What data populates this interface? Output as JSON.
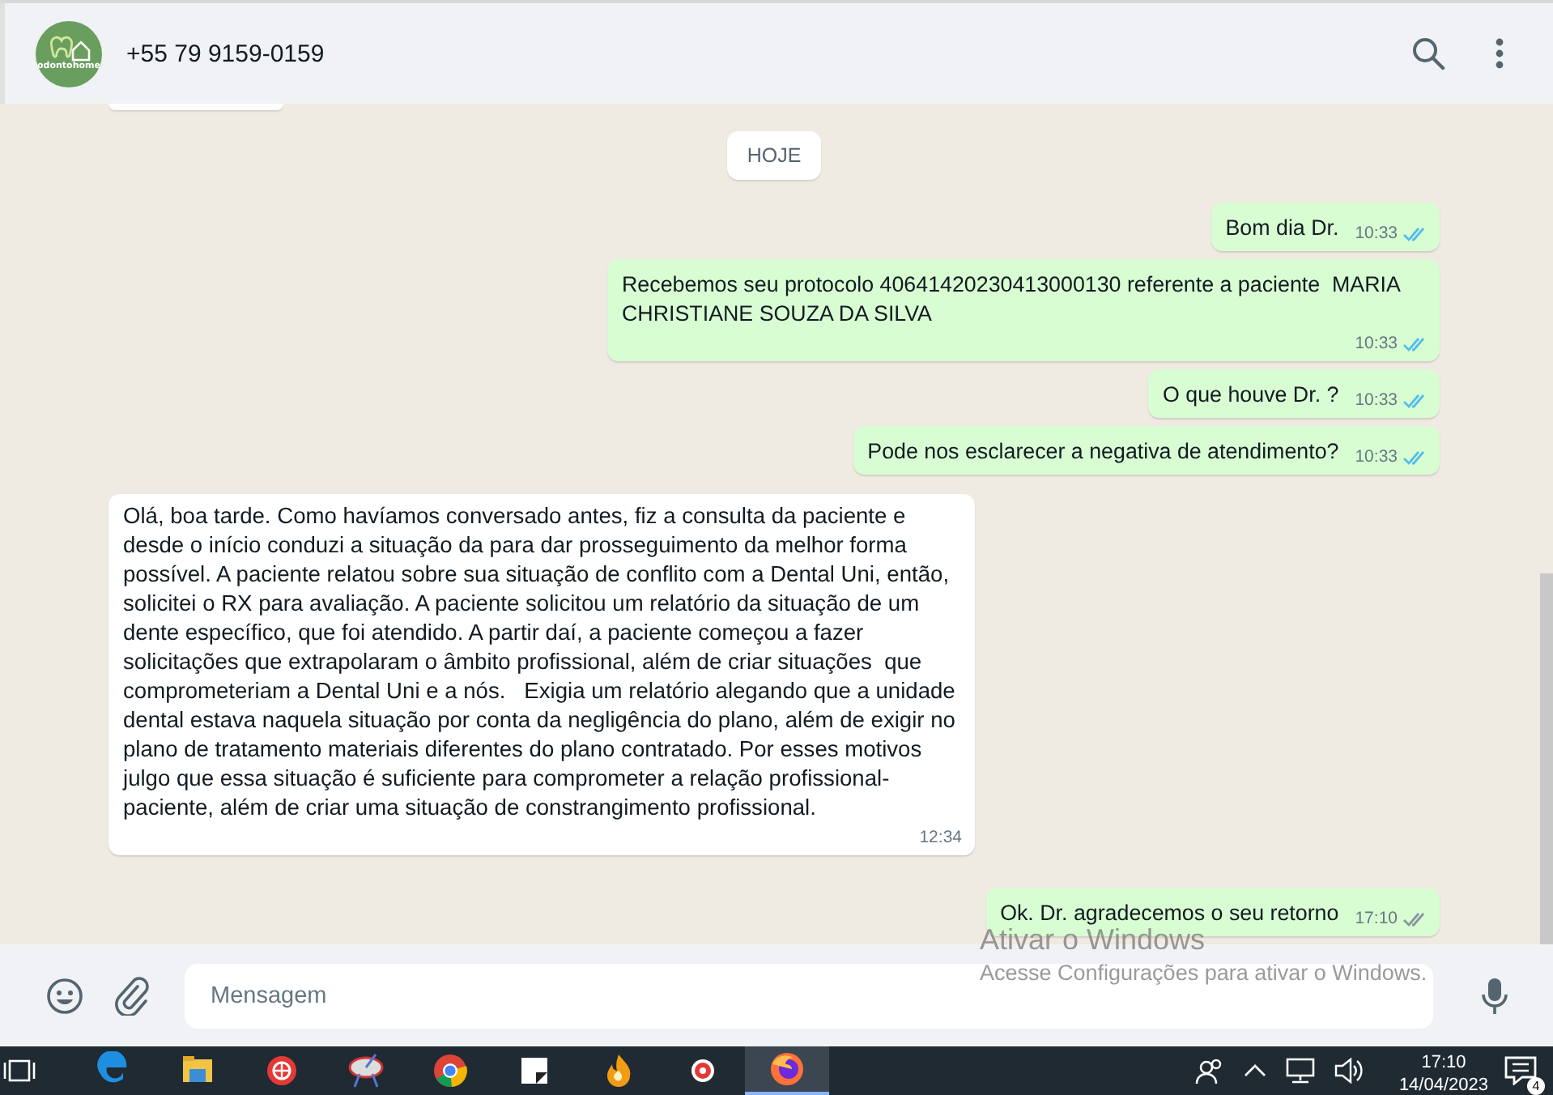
{
  "header": {
    "contact": "+55 79 9159-0159",
    "avatar_label": "odontohome"
  },
  "date_chip": "HOJE",
  "messages": [
    {
      "kind": "outgoing",
      "text": "Bom dia Dr.",
      "time": "10:33",
      "read": true
    },
    {
      "kind": "outgoing",
      "text": "Recebemos seu protocolo 40641420230413000130 referente a paciente  MARIA CHRISTIANE SOUZA DA SILVA",
      "time": "10:33",
      "read": true
    },
    {
      "kind": "outgoing",
      "text": "O que houve Dr. ?",
      "time": "10:33",
      "read": true
    },
    {
      "kind": "outgoing",
      "text": "Pode nos esclarecer a negativa de atendimento?",
      "time": "10:33",
      "read": true
    },
    {
      "kind": "incoming",
      "text": "Olá, boa tarde. Como havíamos conversado antes, fiz a consulta da paciente e desde o início conduzi a situação da para dar prosseguimento da melhor forma possível. A paciente relatou sobre sua situação de conflito com a Dental Uni, então, solicitei o RX para avaliação. A paciente solicitou um relatório da situação de um dente específico, que foi atendido. A partir daí, a paciente começou a fazer solicitações que extrapolaram o âmbito profissional, além de criar situações  que comprometeriam a Dental Uni e a nós.   Exigia um relatório alegando que a unidade dental estava naquela situação por conta da negligência do plano, além de exigir no plano de tratamento materiais diferentes do plano contratado. Por esses motivos julgo que essa situação é suficiente para comprometer a relação profissional-paciente, além de criar uma situação de constrangimento profissional.",
      "time": "12:34"
    },
    {
      "kind": "outgoing",
      "text": "Ok. Dr. agradecemos o seu retorno",
      "time": "17:10",
      "read": false
    }
  ],
  "composer": {
    "placeholder": "Mensagem"
  },
  "activation_notice": {
    "title": "Ativar o Windows",
    "text": "Acesse Configurações para ativar o Windows."
  },
  "taskbar": {
    "time": "17:10",
    "date": "14/04/2023",
    "notifications": "4"
  }
}
